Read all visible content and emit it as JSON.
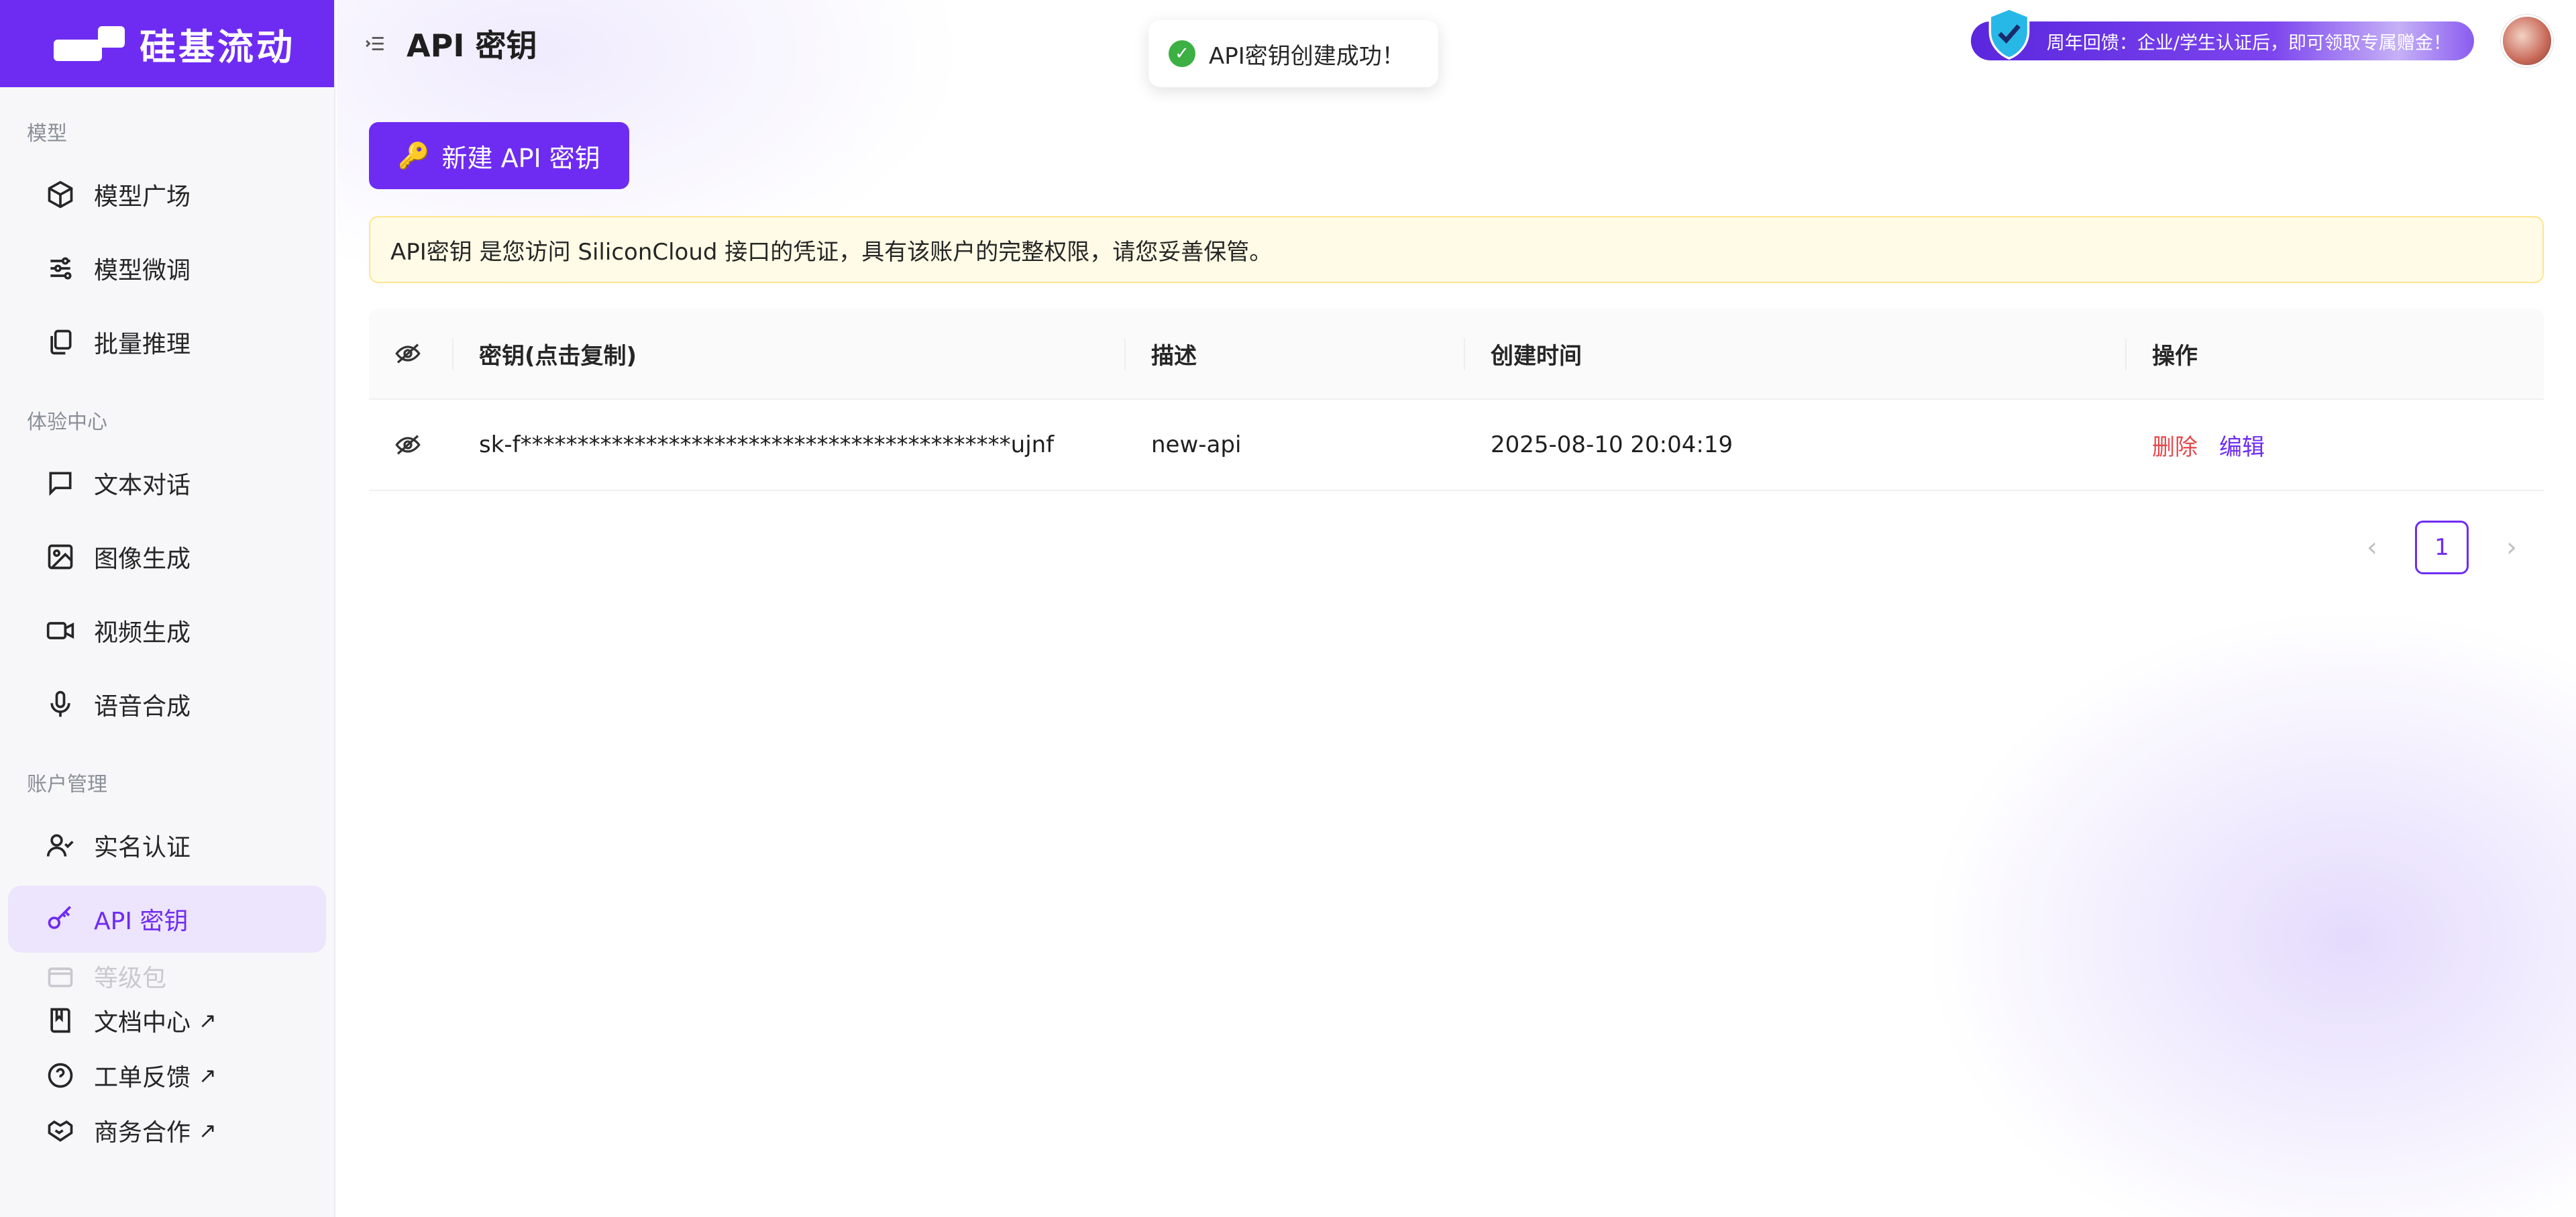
{
  "brand": {
    "name": "硅基流动"
  },
  "sidebar": {
    "groups": [
      {
        "title": "模型",
        "items": [
          {
            "label": "模型广场",
            "icon": "cube-icon"
          },
          {
            "label": "模型微调",
            "icon": "sliders-icon"
          },
          {
            "label": "批量推理",
            "icon": "copy-icon"
          }
        ]
      },
      {
        "title": "体验中心",
        "items": [
          {
            "label": "文本对话",
            "icon": "chat-icon"
          },
          {
            "label": "图像生成",
            "icon": "image-icon"
          },
          {
            "label": "视频生成",
            "icon": "video-icon"
          },
          {
            "label": "语音合成",
            "icon": "mic-icon"
          }
        ]
      },
      {
        "title": "账户管理",
        "items": [
          {
            "label": "实名认证",
            "icon": "user-check-icon"
          },
          {
            "label": "API 密钥",
            "icon": "key-icon",
            "active": true
          },
          {
            "label": "等级包",
            "icon": "wallet-icon"
          }
        ]
      }
    ],
    "footer_links": [
      {
        "label": "文档中心",
        "arrow": "↗",
        "icon": "book-icon"
      },
      {
        "label": "工单反馈",
        "arrow": "↗",
        "icon": "help-icon"
      },
      {
        "label": "商务合作",
        "arrow": "↗",
        "icon": "handshake-icon"
      }
    ]
  },
  "header": {
    "title": "API 密钥",
    "promo_text": "周年回馈：企业/学生认证后，即可领取专属赠金！"
  },
  "toast": {
    "message": "API密钥创建成功！",
    "status_color": "#3cb043"
  },
  "actions": {
    "new_key_label": "新建 API 密钥",
    "new_key_icon": "🔑"
  },
  "notice": {
    "text": "API密钥 是您访问 SiliconCloud 接口的凭证，具有该账户的完整权限，请您妥善保管。"
  },
  "table": {
    "headers": {
      "key": "密钥(点击复制)",
      "description": "描述",
      "created": "创建时间",
      "actions": "操作"
    },
    "rows": [
      {
        "key": "sk-f*******************************************ujnf",
        "description": "new-api",
        "created": "2025-08-10 20:04:19",
        "delete_label": "删除",
        "edit_label": "编辑"
      }
    ]
  },
  "pagination": {
    "current": "1",
    "prev": "‹",
    "next": "›"
  },
  "colors": {
    "accent": "#6e2cf2",
    "danger": "#e5484d",
    "notice_bg": "#fffbe6"
  }
}
